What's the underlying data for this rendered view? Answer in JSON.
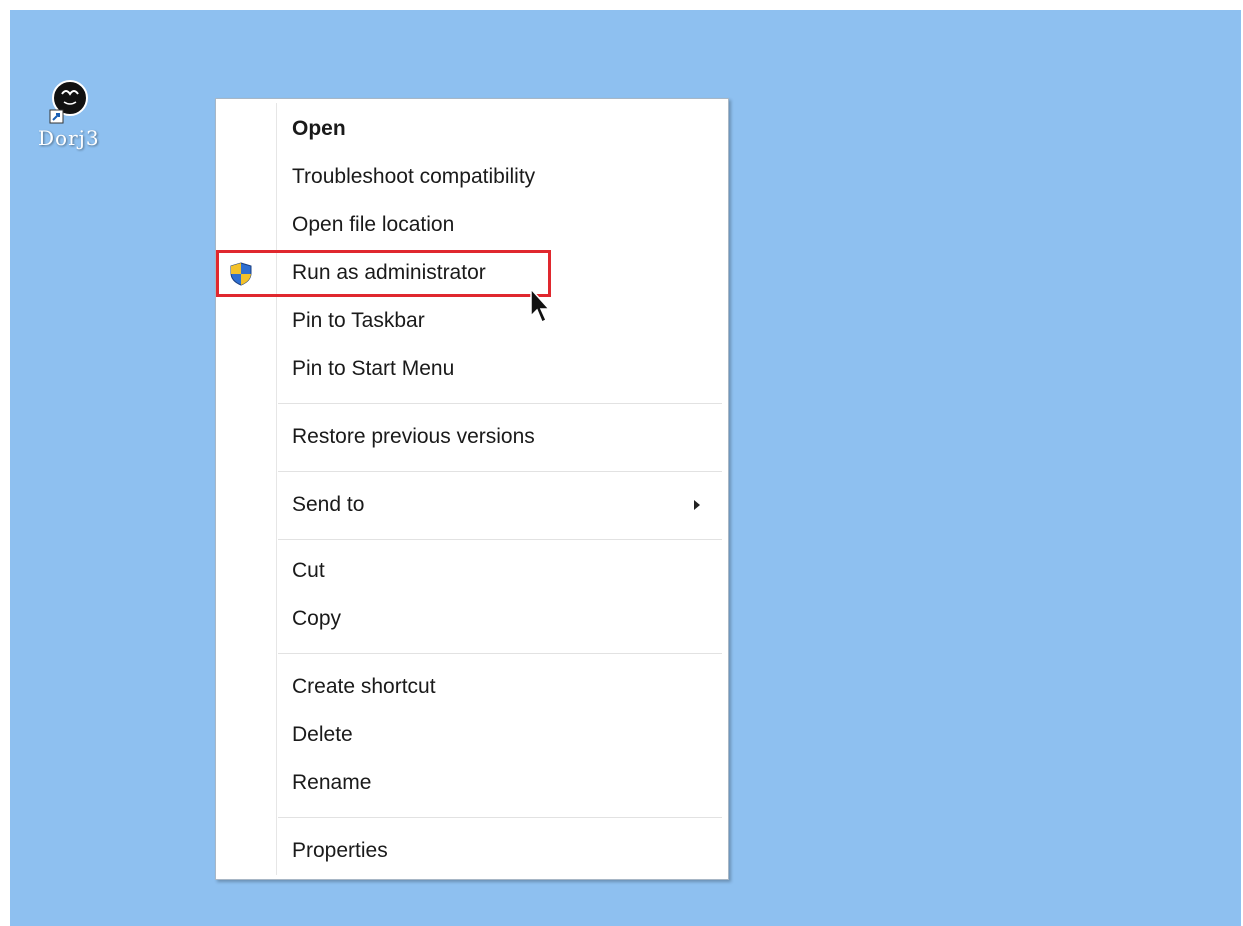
{
  "desktop": {
    "background_color": "#8ec0f0",
    "icon": {
      "label": "Dorj3",
      "icon": "shortcut-app-icon"
    }
  },
  "context_menu": {
    "items": [
      {
        "label": "Open",
        "default": true
      },
      {
        "label": "Troubleshoot compatibility"
      },
      {
        "label": "Open file location"
      },
      {
        "label": "Run as administrator",
        "icon": "uac-shield-icon",
        "highlighted": true,
        "highlight_color": "#e0282e"
      },
      {
        "label": "Pin to Taskbar"
      },
      {
        "label": "Pin to Start Menu"
      },
      {
        "label": "Restore previous versions"
      },
      {
        "label": "Send to",
        "submenu": true
      },
      {
        "label": "Cut"
      },
      {
        "label": "Copy"
      },
      {
        "label": "Create shortcut"
      },
      {
        "label": "Delete"
      },
      {
        "label": "Rename"
      },
      {
        "label": "Properties"
      }
    ]
  },
  "cursor": {
    "icon": "mouse-pointer-icon"
  }
}
